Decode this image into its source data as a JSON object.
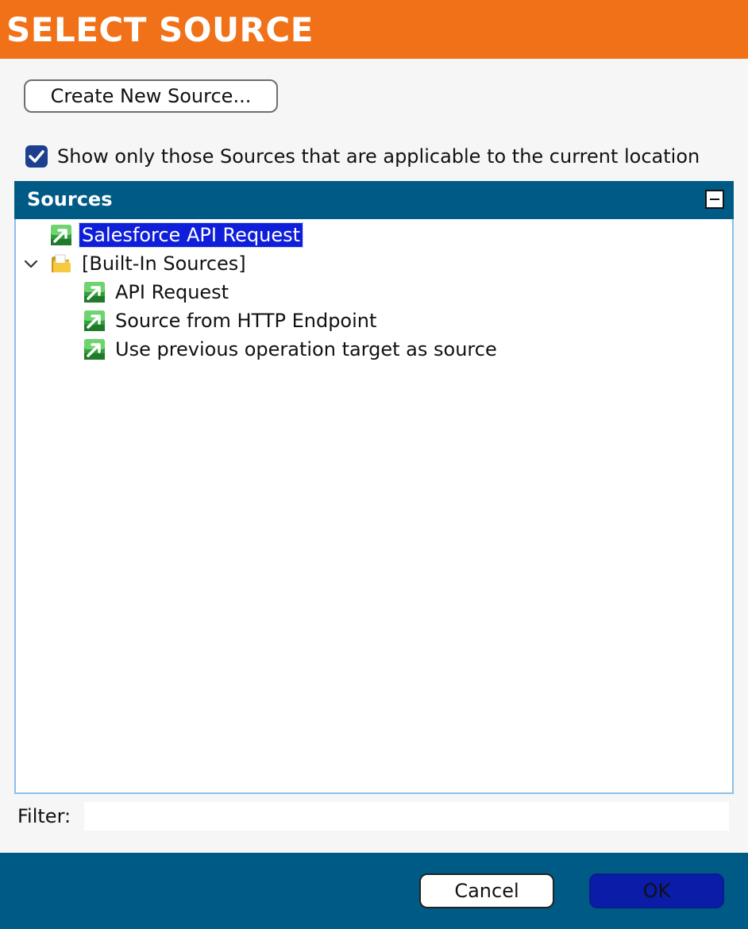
{
  "dialog": {
    "title": "SELECT SOURCE"
  },
  "create_button_label": "Create New Source...",
  "filter_checkbox": {
    "checked": true,
    "label": "Show only those Sources that are applicable to the current location"
  },
  "sources_panel": {
    "title": "Sources",
    "collapse_icon": "minus-square-icon",
    "tree": {
      "items": [
        {
          "label": "Salesforce API Request",
          "icon": "source-activity-icon",
          "selected": true
        },
        {
          "label": "[Built-In Sources]",
          "icon": "folder-icon",
          "expanded": true,
          "children": [
            {
              "label": "API Request",
              "icon": "source-activity-icon"
            },
            {
              "label": "Source from HTTP Endpoint",
              "icon": "source-activity-icon"
            },
            {
              "label": "Use previous operation target as source",
              "icon": "source-activity-icon"
            }
          ]
        }
      ]
    }
  },
  "filter": {
    "label": "Filter:",
    "value": "",
    "placeholder": ""
  },
  "footer": {
    "cancel_label": "Cancel",
    "ok_label": "OK"
  },
  "colors": {
    "header_bg": "#f07117",
    "panel_header_bg": "#005a86",
    "selection_bg": "#0f1fd9",
    "ok_button_bg": "#0a1ca8",
    "checkbox_bg": "#1c3f8f"
  }
}
